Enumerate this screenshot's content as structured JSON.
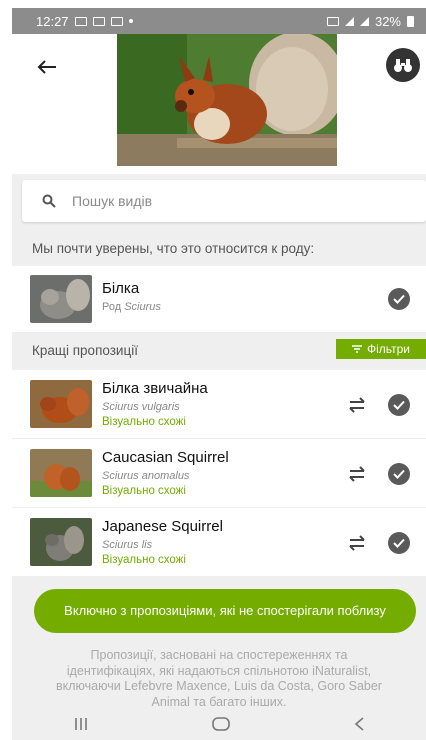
{
  "status_bar": {
    "time": "12:27",
    "battery": "32%"
  },
  "search": {
    "placeholder": "Пошук видів"
  },
  "genus_section": {
    "heading": "Мы почти уверены, что это относится к роду:",
    "name": "Білка",
    "rank_label": "Род",
    "rank_name": "Sciurus"
  },
  "suggestions": {
    "heading": "Кращі пропозиції",
    "filters_label": "Фільтри",
    "items": [
      {
        "name": "Білка звичайна",
        "scientific": "Sciurus vulgaris",
        "tag": "Візуально схожі"
      },
      {
        "name": "Caucasian Squirrel",
        "scientific": "Sciurus anomalus",
        "tag": "Візуально схожі"
      },
      {
        "name": "Japanese Squirrel",
        "scientific": "Sciurus lis",
        "tag": "Візуально схожі"
      }
    ]
  },
  "cta": {
    "label": "Включно з пропозиціями, які не спостерігали поблизу"
  },
  "footer": {
    "note": "Пропозиції, засновані на спостереженнях та ідентифікаціях, які надаються спільнотою iNaturalist, включаючи Lefebvre Maxence, Luis da Costa, Goro Saber Animal та багато інших."
  },
  "colors": {
    "accent": "#74ac00",
    "check": "#5a5a5a"
  },
  "icons": [
    "back-arrow-icon",
    "binoculars-icon",
    "search-icon",
    "check-icon",
    "compare-icon",
    "filter-icon"
  ]
}
